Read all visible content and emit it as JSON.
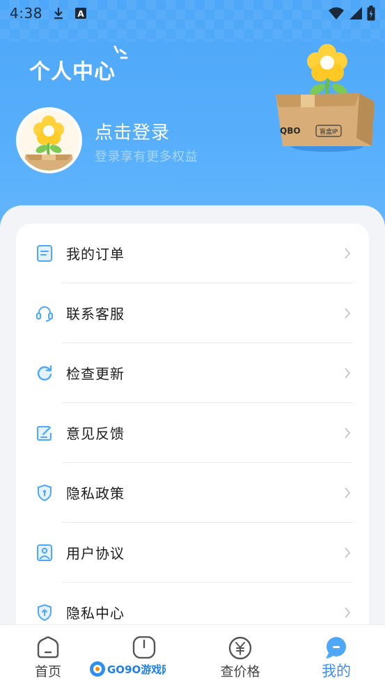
{
  "status_bar": {
    "time": "4:38",
    "icons": [
      "download-icon",
      "a-notification-icon",
      "wifi-icon",
      "signal-icon",
      "battery-icon"
    ]
  },
  "header": {
    "title": "个人中心"
  },
  "profile": {
    "login_title": "点击登录",
    "login_subtitle": "登录享有更多权益",
    "decoration": {
      "box_text": "QBO",
      "box_tag": "盲盒IP"
    }
  },
  "menu": {
    "items": [
      {
        "label": "我的订单",
        "icon": "order-icon"
      },
      {
        "label": "联系客服",
        "icon": "headset-icon"
      },
      {
        "label": "检查更新",
        "icon": "refresh-icon"
      },
      {
        "label": "意见反馈",
        "icon": "feedback-icon"
      },
      {
        "label": "隐私政策",
        "icon": "shield-icon"
      },
      {
        "label": "用户协议",
        "icon": "agreement-icon"
      },
      {
        "label": "隐私中心",
        "icon": "shield-icon"
      }
    ]
  },
  "tabbar": {
    "tabs": [
      {
        "label": "首页",
        "icon": "home-icon",
        "active": false
      },
      {
        "label": "",
        "icon": "power-icon",
        "active": false
      },
      {
        "label": "查价格",
        "icon": "price-icon",
        "active": false
      },
      {
        "label": "我的",
        "icon": "profile-icon",
        "active": true
      }
    ]
  },
  "watermark": {
    "text": "GO9O游戏网"
  },
  "colors": {
    "accent": "#3a8ff7",
    "hero_top": "#4ea7f8",
    "icon_blue": "#4ea7f8"
  }
}
